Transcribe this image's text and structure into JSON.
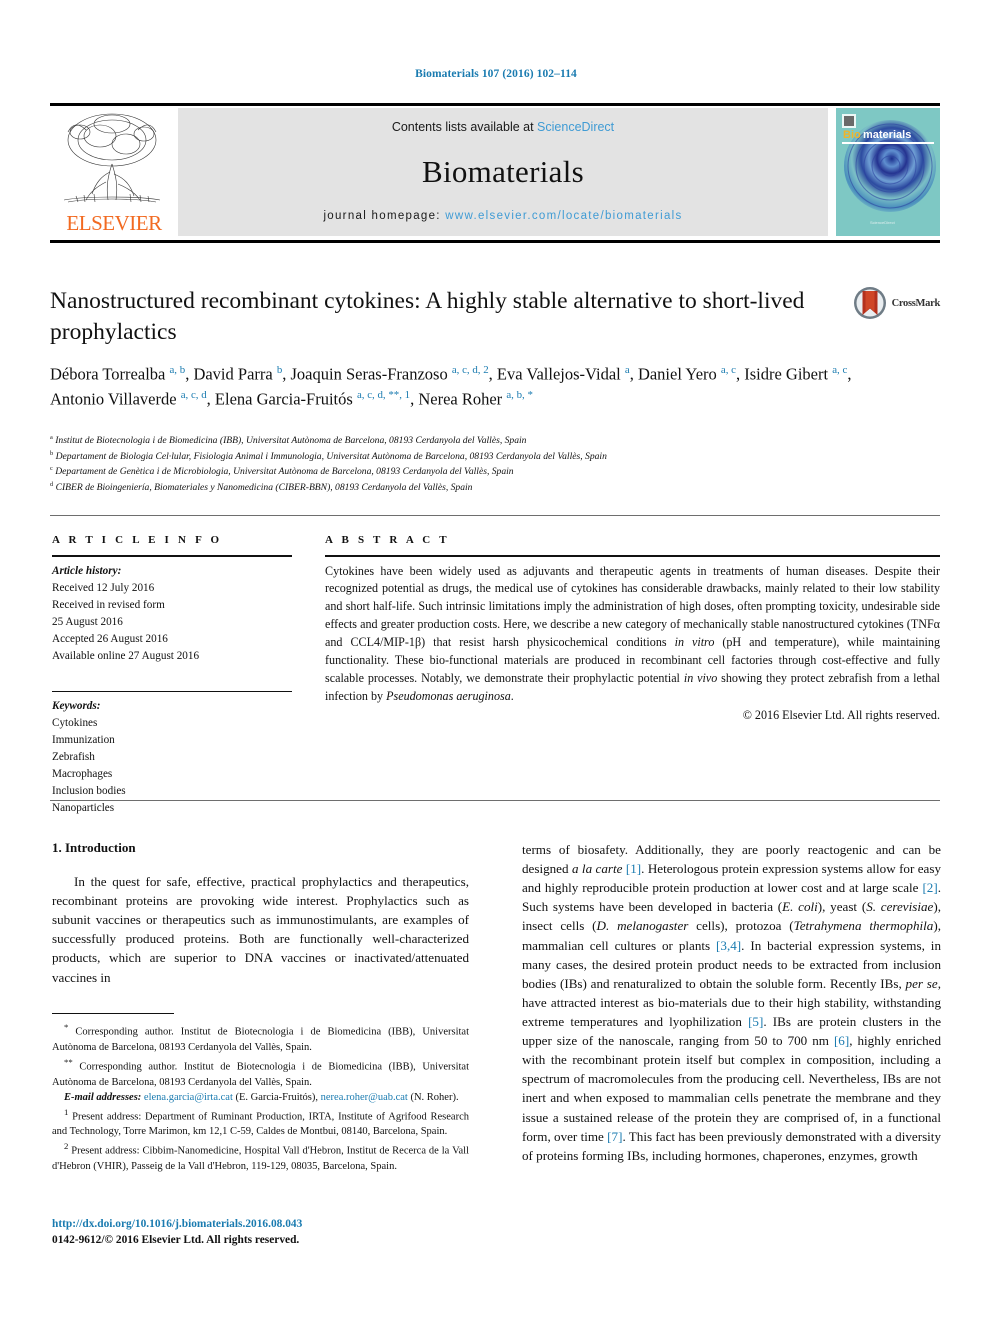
{
  "running_head": "Biomaterials 107 (2016) 102–114",
  "journal_header": {
    "contents_prefix": "Contents lists available at ",
    "sciencedirect": "ScienceDirect",
    "journal_name": "Biomaterials",
    "homepage_prefix": "journal homepage: ",
    "homepage_url": "www.elsevier.com/locate/biomaterials",
    "publisher": "ELSEVIER",
    "cover_title_bio": "Bio",
    "cover_title_materials": "materials",
    "accent_link": "#3f9bd4",
    "accent_orange": "#f26a21"
  },
  "article": {
    "title": "Nanostructured recombinant cytokines: A highly stable alternative to short-lived prophylactics",
    "crossmark_label": "CrossMark"
  },
  "authors_html": "Débora Torrealba <sup>a, b</sup>, David Parra <sup>b</sup>, Joaquin Seras-Franzoso <sup>a, c, d, 2</sup>, Eva Vallejos-Vidal <sup>a</sup>, Daniel Yero <sup>a, c</sup>, Isidre Gibert <sup>a, c</sup>, Antonio Villaverde <sup>a, c, d</sup>, Elena Garcia-Fruitós <sup>a, c, d, **, 1</sup>, Nerea Roher <sup>a, b, *</sup>",
  "affiliations": [
    {
      "marker": "a",
      "text": "Institut de Biotecnologia i de Biomedicina (IBB), Universitat Autònoma de Barcelona, 08193 Cerdanyola del Vallès, Spain"
    },
    {
      "marker": "b",
      "text": "Departament de Biologia Cel·lular, Fisiologia Animal i Immunologia, Universitat Autònoma de Barcelona, 08193 Cerdanyola del Vallès, Spain"
    },
    {
      "marker": "c",
      "text": "Departament de Genètica i de Microbiologia, Universitat Autònoma de Barcelona, 08193 Cerdanyola del Vallès, Spain"
    },
    {
      "marker": "d",
      "text": "CIBER de Bioingeniería, Biomateriales y Nanomedicina (CIBER-BBN), 08193 Cerdanyola del Vallès, Spain"
    }
  ],
  "article_info": {
    "heading": "A R T I C L E   I N F O",
    "history_label": "Article history:",
    "history": [
      "Received 12 July 2016",
      "Received in revised form",
      "25 August 2016",
      "Accepted 26 August 2016",
      "Available online 27 August 2016"
    ],
    "keywords_label": "Keywords:",
    "keywords": [
      "Cytokines",
      "Immunization",
      "Zebrafish",
      "Macrophages",
      "Inclusion bodies",
      "Nanoparticles"
    ]
  },
  "abstract": {
    "heading": "A B S T R A C T",
    "html": "Cytokines have been widely used as adjuvants and therapeutic agents in treatments of human diseases. Despite their recognized potential as drugs, the medical use of cytokines has considerable drawbacks, mainly related to their low stability and short half-life. Such intrinsic limitations imply the administration of high doses, often prompting toxicity, undesirable side effects and greater production costs. Here, we describe a new category of mechanically stable nanostructured cytokines (TNF&#945; and CCL4/MIP-1&#946;) that resist harsh physicochemical conditions <i>in vitro</i> (pH and temperature), while maintaining functionality. These bio-functional materials are produced in recombinant cell factories through cost-effective and fully scalable processes. Notably, we demonstrate their prophylactic potential <i>in vivo</i> showing they protect zebrafish from a lethal infection by <i>Pseudomonas aeruginosa</i>.",
    "copyright": "© 2016 Elsevier Ltd. All rights reserved."
  },
  "body": {
    "section_heading": "1. Introduction",
    "left_paragraph_html": "In the quest for safe, effective, practical prophylactics and therapeutics, recombinant proteins are provoking wide interest. Prophylactics such as subunit vaccines or therapeutics such as immunostimulants, are examples of successfully produced proteins. Both are functionally well-characterized products, which are superior to DNA vaccines or inactivated/attenuated vaccines in",
    "right_paragraph_html": "terms of biosafety. Additionally, they are poorly reactogenic and can be designed <i>a la carte</i> <span class=\"ref\">[1]</span>. Heterologous protein expression systems allow for easy and highly reproducible protein production at lower cost and at large scale <span class=\"ref\">[2]</span>. Such systems have been developed in bacteria (<i>E. coli</i>), yeast (<i>S. cerevisiae</i>), insect cells (<i>D. melanogaster</i> cells), protozoa (<i>Tetrahymena thermophila</i>), mammalian cell cultures or plants <span class=\"ref\">[3,4]</span>. In bacterial expression systems, in many cases, the desired protein product needs to be extracted from inclusion bodies (IBs) and renaturalized to obtain the soluble form. Recently IBs, <i>per se</i>, have attracted interest as bio-materials due to their high stability, withstanding extreme temperatures and lyophilization <span class=\"ref\">[5]</span>. IBs are protein clusters in the upper size of the nanoscale, ranging from 50 to 700 nm <span class=\"ref\">[6]</span>, highly enriched with the recombinant protein itself but complex in composition, including a spectrum of macromolecules from the producing cell. Nevertheless, IBs are not inert and when exposed to mammalian cells penetrate the membrane and they issue a sustained release of the protein they are comprised of, in a functional form, over time <span class=\"ref\">[7]</span>. This fact has been previously demonstrated with a diversity of proteins forming IBs, including hormones, chaperones, enzymes, growth"
  },
  "footnotes": [
    {
      "html": "<sup>*</sup> Corresponding author. Institut de Biotecnologia i de Biomedicina (IBB), Universitat Autònoma de Barcelona, 08193 Cerdanyola del Vallès, Spain."
    },
    {
      "html": "<sup>**</sup> Corresponding author. Institut de Biotecnologia i de Biomedicina (IBB), Universitat Autònoma de Barcelona, 08193 Cerdanyola del Vallès, Spain."
    },
    {
      "html": "<span class=\"lbl\">E-mail addresses:</span> <span class=\"link\">elena.garcia@irta.cat</span> (E. Garcia-Fruitós), <span class=\"link\">nerea.roher@uab.cat</span> (N. Roher)."
    },
    {
      "html": "<sup>1</sup> Present address: Department of Ruminant Production, IRTA, Institute of Agrifood Research and Technology, Torre Marimon, km 12,1 C-59, Caldes de Montbui, 08140, Barcelona, Spain."
    },
    {
      "html": "<sup>2</sup> Present address: Cibbim-Nanomedicine, Hospital Vall d'Hebron, Institut de Recerca de la Vall d'Hebron (VHIR), Passeig de la Vall d'Hebron, 119-129, 08035, Barcelona, Spain."
    }
  ],
  "doi": {
    "url": "http://dx.doi.org/10.1016/j.biomaterials.2016.08.043",
    "issn_line": "0142-9612/© 2016 Elsevier Ltd. All rights reserved."
  }
}
